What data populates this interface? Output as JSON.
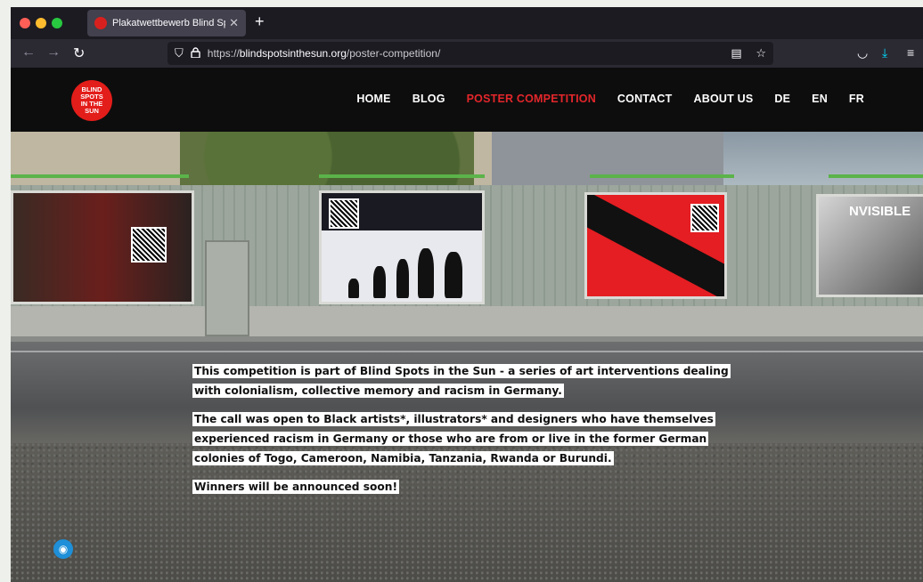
{
  "browser": {
    "tab_title": "Plakatwettbewerb Blind Spots in",
    "url_prefix": "https://",
    "url_domain": "blindspotsinthesun.org",
    "url_path": "/poster-competition/"
  },
  "site": {
    "logo_text": "BLIND\nSPOTS\nIN THE\nSUN",
    "nav": [
      "HOME",
      "BLOG",
      "POSTER COMPETITION",
      "CONTACT",
      "ABOUT US",
      "DE",
      "EN",
      "FR"
    ],
    "active_nav": "POSTER COMPETITION",
    "accent_color": "#e3262b"
  },
  "hero": {
    "poster_word": "NVISIBLE",
    "paragraphs": [
      "This competition is part of Blind Spots in the Sun - a series of art interventions dealing with colonialism, collective memory and racism in Germany.",
      "The call was open to Black artists*, illustrators* and designers who have themselves experienced racism in Germany or those who are from or live in the former German colonies of Togo, Cameroon, Namibia, Tanzania, Rwanda or Burundi.",
      "Winners will be announced soon!"
    ]
  },
  "icons": {
    "back": "←",
    "forward": "→",
    "reload": "↻",
    "shield": "⛉",
    "lock": "🔒",
    "reader": "▤",
    "bookmark": "☆",
    "pocket": "◡",
    "download": "⤓",
    "menu": "≡",
    "close": "✕",
    "new_tab": "+",
    "cookie": "◉"
  }
}
